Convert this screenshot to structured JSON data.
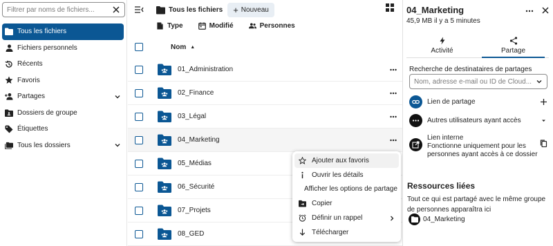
{
  "sidebar": {
    "filter_placeholder": "Filtrer par noms de fichiers...",
    "items": [
      {
        "label": "Tous les fichiers",
        "icon": "folder-icon",
        "active": true
      },
      {
        "label": "Fichiers personnels",
        "icon": "person-icon"
      },
      {
        "label": "Récents",
        "icon": "history-icon"
      },
      {
        "label": "Favoris",
        "icon": "star-icon"
      },
      {
        "label": "Partages",
        "icon": "share-icon",
        "expandable": true
      },
      {
        "label": "Dossiers de groupe",
        "icon": "group-folder-icon"
      },
      {
        "label": "Étiquettes",
        "icon": "tag-icon"
      },
      {
        "label": "Tous les dossiers",
        "icon": "folders-icon",
        "expandable": true
      }
    ]
  },
  "header": {
    "breadcrumb": "Tous les fichiers",
    "new_button": "Nouveau"
  },
  "filters": {
    "type": "Type",
    "modified": "Modifié",
    "people": "Personnes"
  },
  "table": {
    "name_header": "Nom",
    "rows": [
      "01_Administration",
      "02_Finance",
      "03_Légal",
      "04_Marketing",
      "05_Médias",
      "06_Sécurité",
      "07_Projets",
      "08_GED"
    ]
  },
  "context_menu": {
    "items": [
      {
        "label": "Ajouter aux favoris",
        "icon": "star-outline-icon"
      },
      {
        "label": "Ouvrir les détails",
        "icon": "info-icon"
      },
      {
        "label": "Afficher les options de partage",
        "icon": "share-user-icon"
      },
      {
        "label": "Copier",
        "icon": "copy-folder-icon"
      },
      {
        "label": "Définir un rappel",
        "icon": "alarm-icon",
        "submenu": true
      },
      {
        "label": "Télécharger",
        "icon": "download-icon"
      }
    ]
  },
  "panel": {
    "title": "04_Marketing",
    "subtitle": "45,9 MB il y a 5 minutes",
    "tabs": [
      {
        "label": "Activité",
        "icon": "lightning-icon"
      },
      {
        "label": "Partage",
        "icon": "share-nodes-icon",
        "active": true
      }
    ],
    "search_label": "Recherche de destinataires de partages",
    "search_placeholder": "Nom, adresse e-mail ou ID de Cloud...",
    "share_link": "Lien de partage",
    "others": "Autres utilisateurs ayant accès",
    "internal_title": "Lien interne",
    "internal_desc": "Fonctionne uniquement pour les personnes ayant accès à ce dossier",
    "resources_title": "Ressources liées",
    "resources_desc": "Tout ce qui est partagé avec le même groupe de personnes apparaîtra ici",
    "resource_item": "04_Marketing"
  },
  "colors": {
    "accent": "#0b5794",
    "hover_row": "#f5f5f5",
    "new_button_bg": "#e8eef4"
  }
}
